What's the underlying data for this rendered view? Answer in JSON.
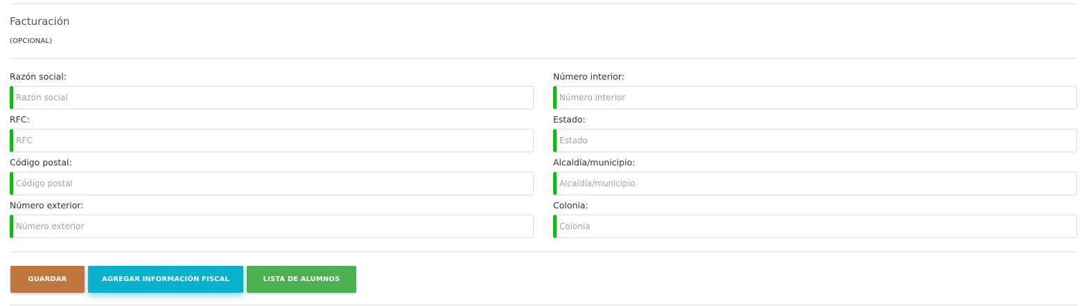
{
  "section": {
    "title": "Facturación",
    "subtitle": "(OPCIONAL)"
  },
  "fields": {
    "razon_social": {
      "label": "Razón social:",
      "placeholder": "Razón social",
      "value": ""
    },
    "rfc": {
      "label": "RFC:",
      "placeholder": "RFC",
      "value": ""
    },
    "codigo_postal": {
      "label": "Código postal:",
      "placeholder": "Código postal",
      "value": ""
    },
    "numero_exterior": {
      "label": "Número exterior:",
      "placeholder": "Número exterior",
      "value": ""
    },
    "numero_interior": {
      "label": "Número interior:",
      "placeholder": "Número interior",
      "value": ""
    },
    "estado": {
      "label": "Estado:",
      "placeholder": "Estado",
      "value": ""
    },
    "alcaldia": {
      "label": "Alcaldía/municipio:",
      "placeholder": "Alcaldía/municipio",
      "value": ""
    },
    "colonia": {
      "label": "Colonia:",
      "placeholder": "Colonia",
      "value": ""
    }
  },
  "actions": {
    "save_label": "GUARDAR",
    "fiscal_label": "AGREGAR INFORMACIÓN FISCAL",
    "students_label": "LISTA DE ALUMNOS"
  },
  "colors": {
    "input_accent": "#19b421",
    "save_button": "#c0773e",
    "fiscal_button": "#0ab1cc",
    "students_button": "#4caf50"
  }
}
